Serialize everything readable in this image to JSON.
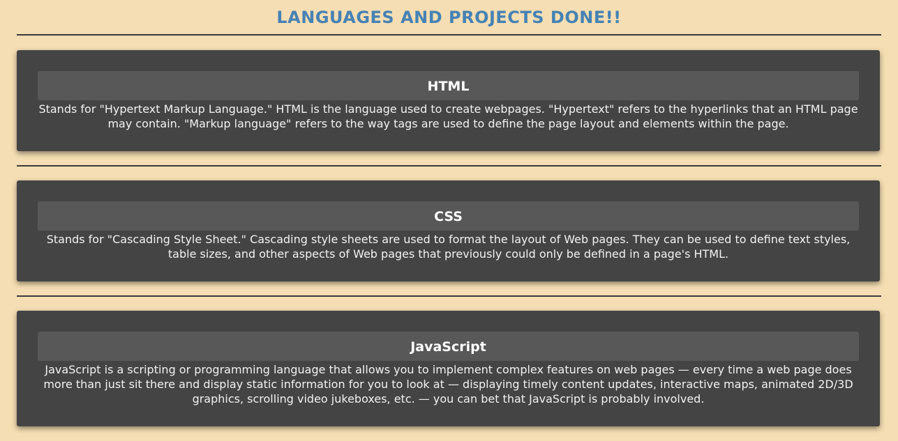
{
  "page": {
    "title": "LANGUAGES AND PROJECTS DONE!!",
    "colors": {
      "background": "#f5deb3",
      "title": "#4682b4",
      "card": "#444444",
      "card_header": "#585858",
      "divider": "#3a3a3a"
    }
  },
  "cards": [
    {
      "heading": "HTML",
      "description": "Stands for \"Hypertext Markup Language.\" HTML is the language used to create webpages. \"Hypertext\" refers to the hyperlinks that an HTML page may contain. \"Markup language\" refers to the way tags are used to define the page layout and elements within the page."
    },
    {
      "heading": "CSS",
      "description": "Stands for \"Cascading Style Sheet.\" Cascading style sheets are used to format the layout of Web pages. They can be used to define text styles, table sizes, and other aspects of Web pages that previously could only be defined in a page's HTML."
    },
    {
      "heading": "JavaScript",
      "description": "JavaScript is a scripting or programming language that allows you to implement complex features on web pages — every time a web page does more than just sit there and display static information for you to look at — displaying timely content updates, interactive maps, animated 2D/3D graphics, scrolling video jukeboxes, etc. — you can bet that JavaScript is probably involved."
    }
  ]
}
